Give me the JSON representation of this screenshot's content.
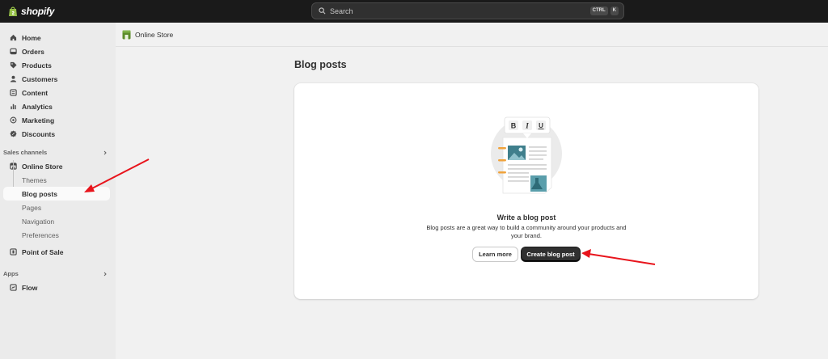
{
  "topbar": {
    "brand": "shopify",
    "search": {
      "placeholder": "Search",
      "shortcut_mod": "CTRL",
      "shortcut_key": "K"
    }
  },
  "sidebar": {
    "main_items": [
      {
        "label": "Home",
        "icon": "home-icon"
      },
      {
        "label": "Orders",
        "icon": "orders-icon"
      },
      {
        "label": "Products",
        "icon": "tag-icon"
      },
      {
        "label": "Customers",
        "icon": "person-icon"
      },
      {
        "label": "Content",
        "icon": "content-icon"
      },
      {
        "label": "Analytics",
        "icon": "bar-chart-icon"
      },
      {
        "label": "Marketing",
        "icon": "target-icon"
      },
      {
        "label": "Discounts",
        "icon": "discount-icon"
      }
    ],
    "sales_channels_title": "Sales channels",
    "online_store": {
      "label": "Online Store",
      "sub_items": [
        "Themes",
        "Blog posts",
        "Pages",
        "Navigation",
        "Preferences"
      ],
      "active_sub": "Blog posts"
    },
    "point_of_sale": "Point of Sale",
    "apps_title": "Apps",
    "flow": "Flow"
  },
  "breadcrumb": {
    "label": "Online Store"
  },
  "page": {
    "title": "Blog posts",
    "empty_state": {
      "title": "Write a blog post",
      "description": "Blog posts are a great way to build a community around your products and your brand.",
      "secondary_button": "Learn more",
      "primary_button": "Create blog post"
    }
  },
  "colors": {
    "topbar": "#1a1a1a",
    "sidebar": "#ebebeb",
    "primary_button": "#303030",
    "annotation_arrow": "#e8141c",
    "illustration_accent": "#f0a33c",
    "illustration_teal": "#5a9eab"
  }
}
